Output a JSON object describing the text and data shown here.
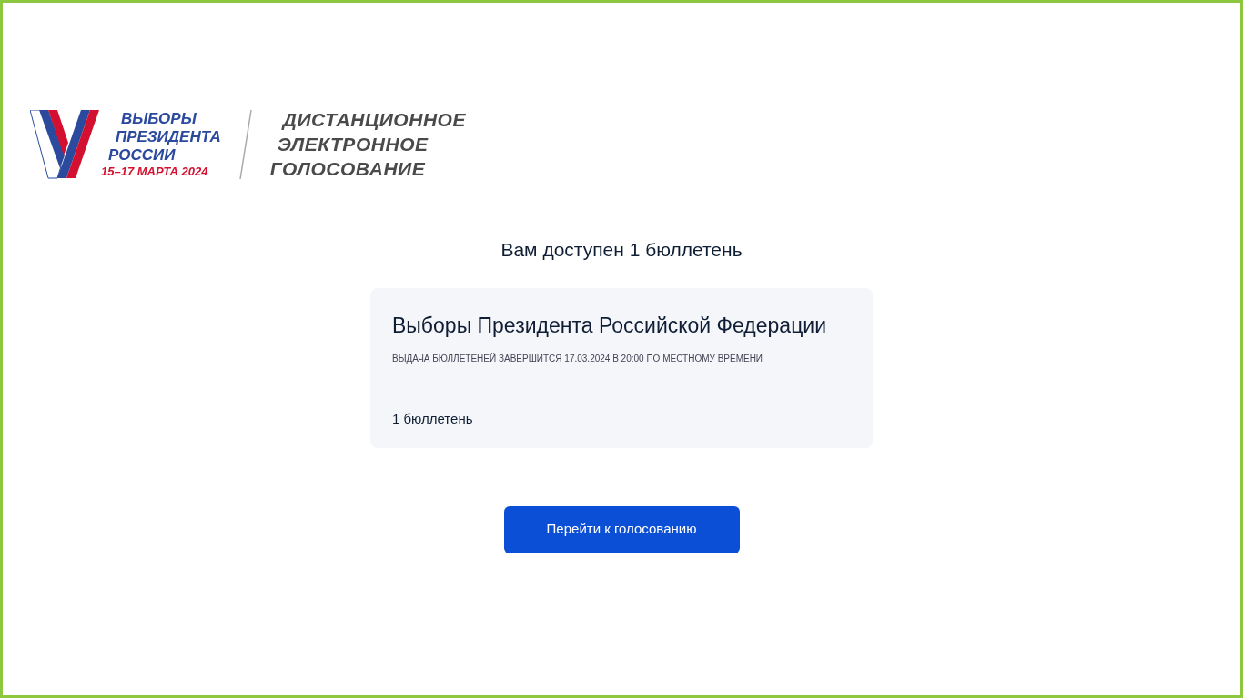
{
  "logo": {
    "election_lines": [
      "ВЫБОРЫ",
      "ПРЕЗИДЕНТА",
      "РОССИИ"
    ],
    "dates": "15–17 МАРТА 2024",
    "service_lines": [
      "ДИСТАНЦИОННОЕ",
      "ЭЛЕКТРОННОЕ",
      "ГОЛОСОВАНИЕ"
    ]
  },
  "heading": "Вам доступен 1 бюллетень",
  "card": {
    "title": "Выборы Президента Российской Федерации",
    "deadline": "ВЫДАЧА БЮЛЛЕТЕНЕЙ ЗАВЕРШИТСЯ 17.03.2024 В 20:00 ПО МЕСТНОМУ ВРЕМЕНИ",
    "count": "1 бюллетень"
  },
  "button": "Перейти к голосованию"
}
